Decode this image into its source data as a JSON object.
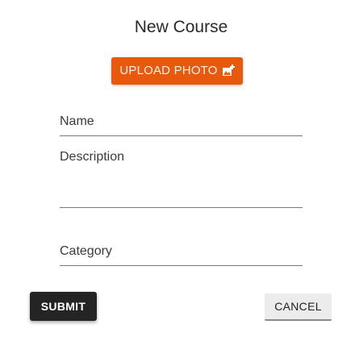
{
  "form": {
    "title": "New Course",
    "upload_button_label": "UPLOAD PHOTO",
    "upload_icon": "add-photo-icon",
    "fields": {
      "name": {
        "label": "Name",
        "value": ""
      },
      "description": {
        "label": "Description",
        "value": ""
      },
      "category": {
        "label": "Category",
        "value": ""
      }
    },
    "submit_label": "SUBMIT",
    "cancel_label": "CANCEL"
  },
  "colors": {
    "accent": "#e8590c",
    "submit_bg": "#242424",
    "cancel_bg": "#ececec"
  }
}
